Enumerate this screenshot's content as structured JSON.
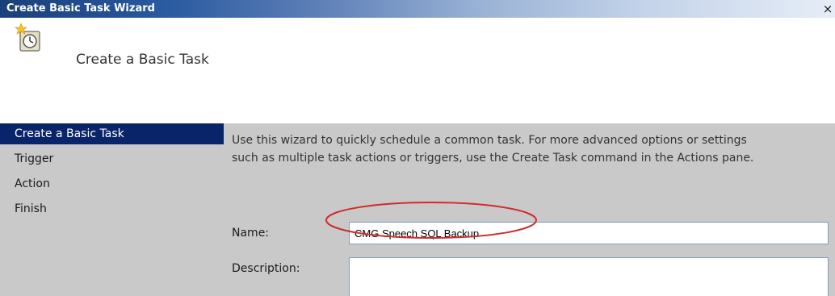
{
  "window": {
    "title": "Create Basic Task Wizard",
    "close_glyph": "×"
  },
  "header": {
    "title": "Create a Basic Task",
    "icon": "task-scheduler-clock-icon"
  },
  "sidebar": {
    "items": [
      {
        "label": "Create a Basic Task",
        "active": true
      },
      {
        "label": "Trigger",
        "active": false
      },
      {
        "label": "Action",
        "active": false
      },
      {
        "label": "Finish",
        "active": false
      }
    ]
  },
  "main": {
    "description_line1": "Use this wizard to quickly schedule a common task.  For more advanced options or settings",
    "description_line2": "such as multiple task actions or triggers, use the Create Task command in the Actions pane.",
    "name_label": "Name:",
    "name_value": "CMG Speech SQL Backup",
    "description_label": "Description:"
  },
  "colors": {
    "highlight": "#d42a2a",
    "selection": "#0a246a",
    "panel": "#c9c9c9"
  }
}
